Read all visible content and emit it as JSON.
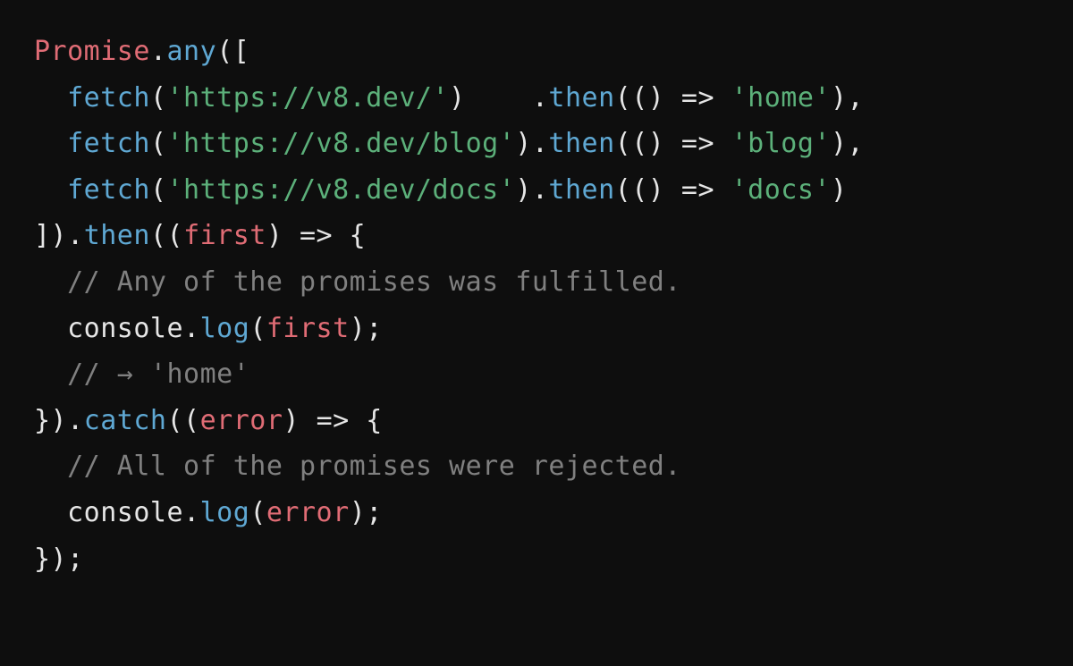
{
  "code": {
    "line1": {
      "class": "Promise",
      "dot": ".",
      "method": "any",
      "open": "(["
    },
    "line2": {
      "indent": "  ",
      "func": "fetch",
      "open": "(",
      "arg": "'https://v8.dev/'",
      "close": ")",
      "pad": "    ",
      "dot": ".",
      "then": "then",
      "topen": "(",
      "params": "()",
      "arrow": " => ",
      "result": "'home'",
      "tclose": "),"
    },
    "line3": {
      "indent": "  ",
      "func": "fetch",
      "open": "(",
      "arg": "'https://v8.dev/blog'",
      "close": ")",
      "dot": ".",
      "then": "then",
      "topen": "(",
      "params": "()",
      "arrow": " => ",
      "result": "'blog'",
      "tclose": "),"
    },
    "line4": {
      "indent": "  ",
      "func": "fetch",
      "open": "(",
      "arg": "'https://v8.dev/docs'",
      "close": ")",
      "dot": ".",
      "then": "then",
      "topen": "(",
      "params": "()",
      "arrow": " => ",
      "result": "'docs'",
      "tclose": ")"
    },
    "line5": {
      "close_arr": "])",
      "dot": ".",
      "then": "then",
      "open": "((",
      "param": "first",
      "mid": ") ",
      "arrow": "=>",
      "brace": " {"
    },
    "line6": {
      "indent": "  ",
      "comment": "// Any of the promises was fulfilled."
    },
    "line7": {
      "indent": "  ",
      "obj": "console",
      "dot": ".",
      "method": "log",
      "open": "(",
      "arg": "first",
      "close": ");"
    },
    "line8": {
      "indent": "  ",
      "comment": "// → 'home'"
    },
    "line9": {
      "close_brace": "})",
      "dot": ".",
      "catch": "catch",
      "open": "((",
      "param": "error",
      "mid": ") ",
      "arrow": "=>",
      "brace": " {"
    },
    "line10": {
      "indent": "  ",
      "comment": "// All of the promises were rejected."
    },
    "line11": {
      "indent": "  ",
      "obj": "console",
      "dot": ".",
      "method": "log",
      "open": "(",
      "arg": "error",
      "close": ");"
    },
    "line12": {
      "text": "});"
    }
  }
}
